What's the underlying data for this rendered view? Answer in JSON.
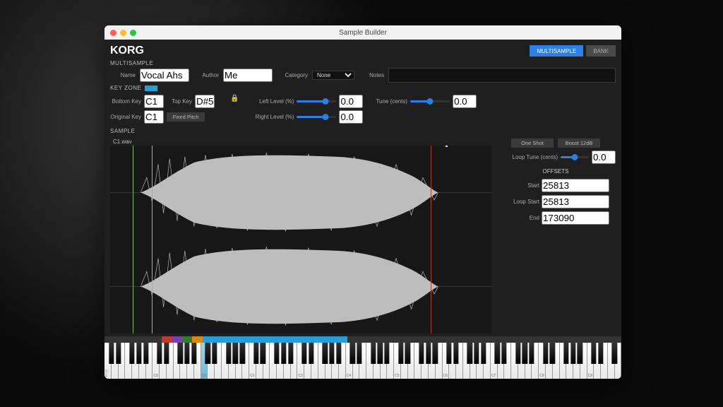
{
  "window": {
    "title": "Sample Builder"
  },
  "logo": "KORG",
  "tabs": {
    "multisample": "MULTISAMPLE",
    "bank": "BANK"
  },
  "multisample": {
    "heading": "MULTISAMPLE",
    "name_label": "Name",
    "name": "Vocal Ahs",
    "author_label": "Author",
    "author": "Me",
    "category_label": "Category",
    "category": "None",
    "notes_label": "Notes",
    "notes": ""
  },
  "keyzone": {
    "heading": "KEY ZONE",
    "bottom_key_label": "Bottom Key",
    "bottom_key": "C1",
    "top_key_label": "Top Key",
    "top_key": "D#5",
    "original_key_label": "Original Key",
    "original_key": "C1",
    "fixed_pitch": "Fixed Pitch",
    "left_level_label": "Left Level (%)",
    "left_level": "0.0",
    "right_level_label": "Right Level (%)",
    "right_level": "0.0",
    "tune_label": "Tune (cents)",
    "tune": "0.0"
  },
  "sample": {
    "heading": "SAMPLE",
    "filename": "C1.wav",
    "one_shot": "One Shot",
    "boost": "Boost 12dB",
    "loop_tune_label": "Loop Tune (cents)",
    "loop_tune": "0.0",
    "offsets_heading": "OFFSETS",
    "start_label": "Start",
    "start": "25813",
    "loop_start_label": "Loop Start",
    "loop_start": "25813",
    "end_label": "End",
    "end": "173090"
  },
  "keyboard": {
    "octave_labels": [
      "C-1",
      "C0",
      "C1",
      "C2",
      "C3",
      "C4",
      "C5",
      "C6",
      "C7",
      "C8",
      "C9"
    ]
  }
}
